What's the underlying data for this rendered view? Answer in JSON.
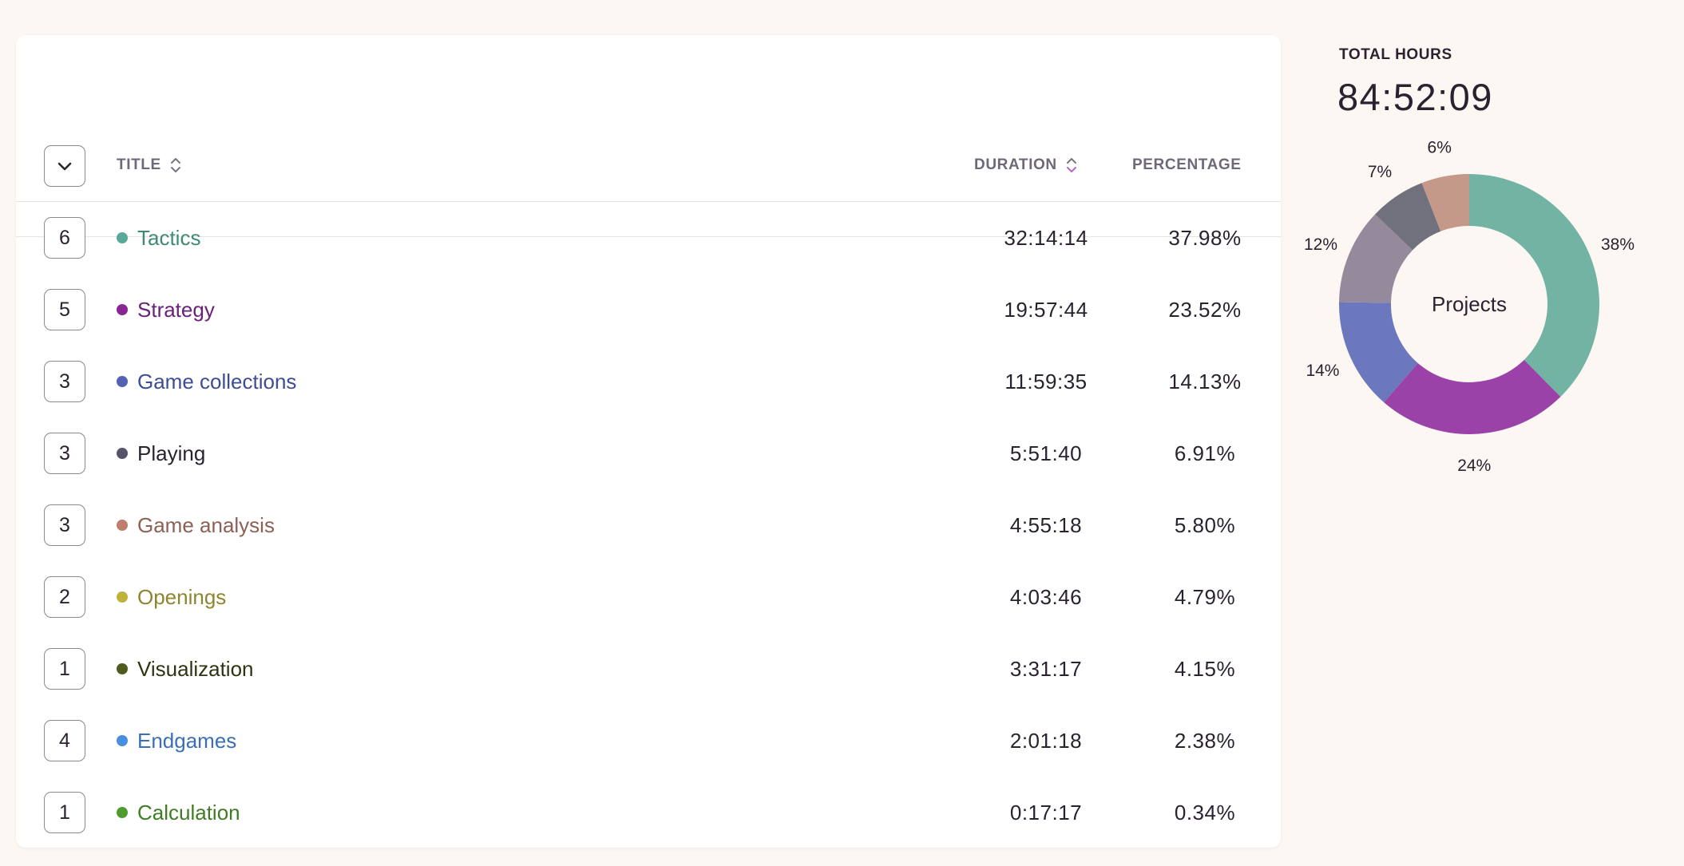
{
  "table": {
    "columns": {
      "title": "TITLE",
      "duration": "DURATION",
      "percentage": "PERCENTAGE"
    },
    "rows": [
      {
        "count": "6",
        "title": "Tactics",
        "duration": "32:14:14",
        "percentage": "37.98%",
        "color": "#5aa897",
        "text_color": "#3f8a77"
      },
      {
        "count": "5",
        "title": "Strategy",
        "duration": "19:57:44",
        "percentage": "23.52%",
        "color": "#8a2694",
        "text_color": "#6a1f78"
      },
      {
        "count": "3",
        "title": "Game collections",
        "duration": "11:59:35",
        "percentage": "14.13%",
        "color": "#5462b3",
        "text_color": "#3e4c95"
      },
      {
        "count": "3",
        "title": "Playing",
        "duration": "5:51:40",
        "percentage": "6.91%",
        "color": "#55536a",
        "text_color": "#2b2230"
      },
      {
        "count": "3",
        "title": "Game analysis",
        "duration": "4:55:18",
        "percentage": "5.80%",
        "color": "#bd7e6d",
        "text_color": "#8d5f55"
      },
      {
        "count": "2",
        "title": "Openings",
        "duration": "4:03:46",
        "percentage": "4.79%",
        "color": "#bfb23a",
        "text_color": "#8f8530"
      },
      {
        "count": "1",
        "title": "Visualization",
        "duration": "3:31:17",
        "percentage": "4.15%",
        "color": "#4d5c1c",
        "text_color": "#2d3413"
      },
      {
        "count": "4",
        "title": "Endgames",
        "duration": "2:01:18",
        "percentage": "2.38%",
        "color": "#4a8ede",
        "text_color": "#3a6fb8"
      },
      {
        "count": "1",
        "title": "Calculation",
        "duration": "0:17:17",
        "percentage": "0.34%",
        "color": "#4f9b2e",
        "text_color": "#3e7d23"
      }
    ]
  },
  "summary": {
    "label": "TOTAL HOURS",
    "value": "84:52:09"
  },
  "chart_data": {
    "type": "pie",
    "center_label": "Projects",
    "slices": [
      {
        "label": "38%",
        "value": 38,
        "color": "#72b3a3"
      },
      {
        "label": "24%",
        "value": 24,
        "color": "#9a42a7"
      },
      {
        "label": "14%",
        "value": 14,
        "color": "#6b78bd"
      },
      {
        "label": "12%",
        "value": 12,
        "color": "#958a9b"
      },
      {
        "label": "7%",
        "value": 7,
        "color": "#71707d"
      },
      {
        "label": "6%",
        "value": 6,
        "color": "#c4998a"
      }
    ]
  },
  "icons": {
    "expand": "chevron-down-icon",
    "sort": "sort-icon"
  }
}
